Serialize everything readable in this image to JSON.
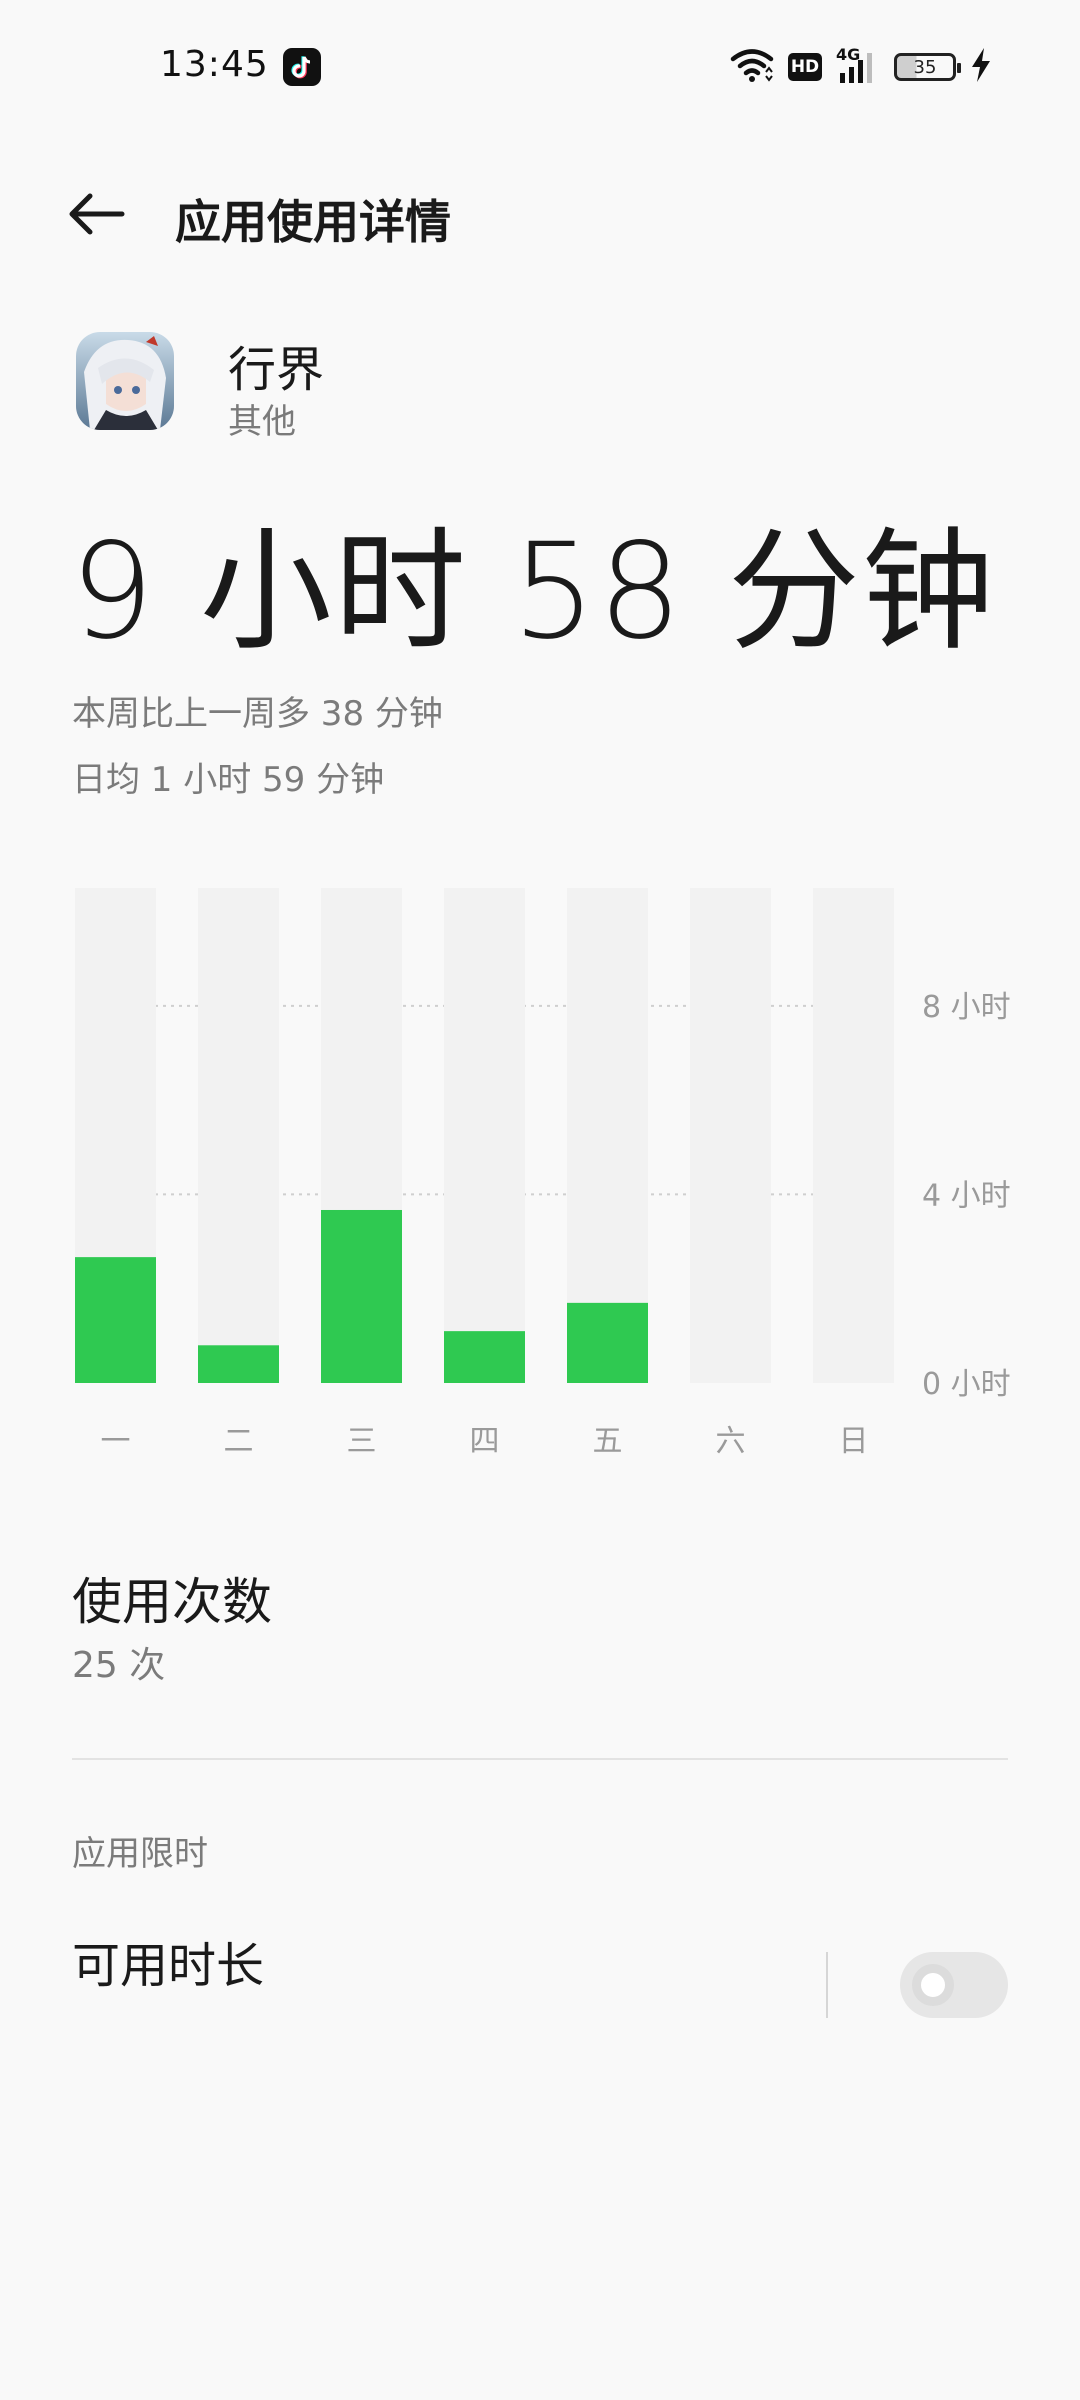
{
  "status_bar": {
    "time": "13:45",
    "battery": "35",
    "network": "4G",
    "hd_badge": "HD",
    "icons": [
      "tiktok-icon",
      "wifi-icon",
      "hd-icon",
      "signal-icon",
      "battery-icon",
      "charging-icon"
    ]
  },
  "header": {
    "title": "应用使用详情",
    "back_icon": "arrow-left-icon"
  },
  "app": {
    "name": "行界",
    "category": "其他"
  },
  "summary": {
    "total_time": "9 小时 58 分钟",
    "week_compare": "本周比上一周多 38 分钟",
    "daily_average": "日均 1 小时 59 分钟"
  },
  "chart_data": {
    "type": "bar",
    "categories": [
      "一",
      "二",
      "三",
      "四",
      "五",
      "六",
      "日"
    ],
    "values": [
      2.67,
      0.8,
      3.67,
      1.1,
      1.7,
      0,
      0
    ],
    "unit": "小时",
    "ylim": [
      0,
      10.5
    ],
    "yticks": [
      {
        "value": 8,
        "label": "8 小时"
      },
      {
        "value": 4,
        "label": "4 小时"
      },
      {
        "value": 0,
        "label": "0 小时"
      }
    ],
    "bar_color": "#2fc951",
    "track_color": "#f2f2f2",
    "grid": "dotted",
    "axis_position": "right"
  },
  "usage": {
    "title": "使用次数",
    "count": "25 次"
  },
  "limits": {
    "section_title": "应用限时",
    "available_duration_label": "可用时长",
    "toggle_on": false
  }
}
